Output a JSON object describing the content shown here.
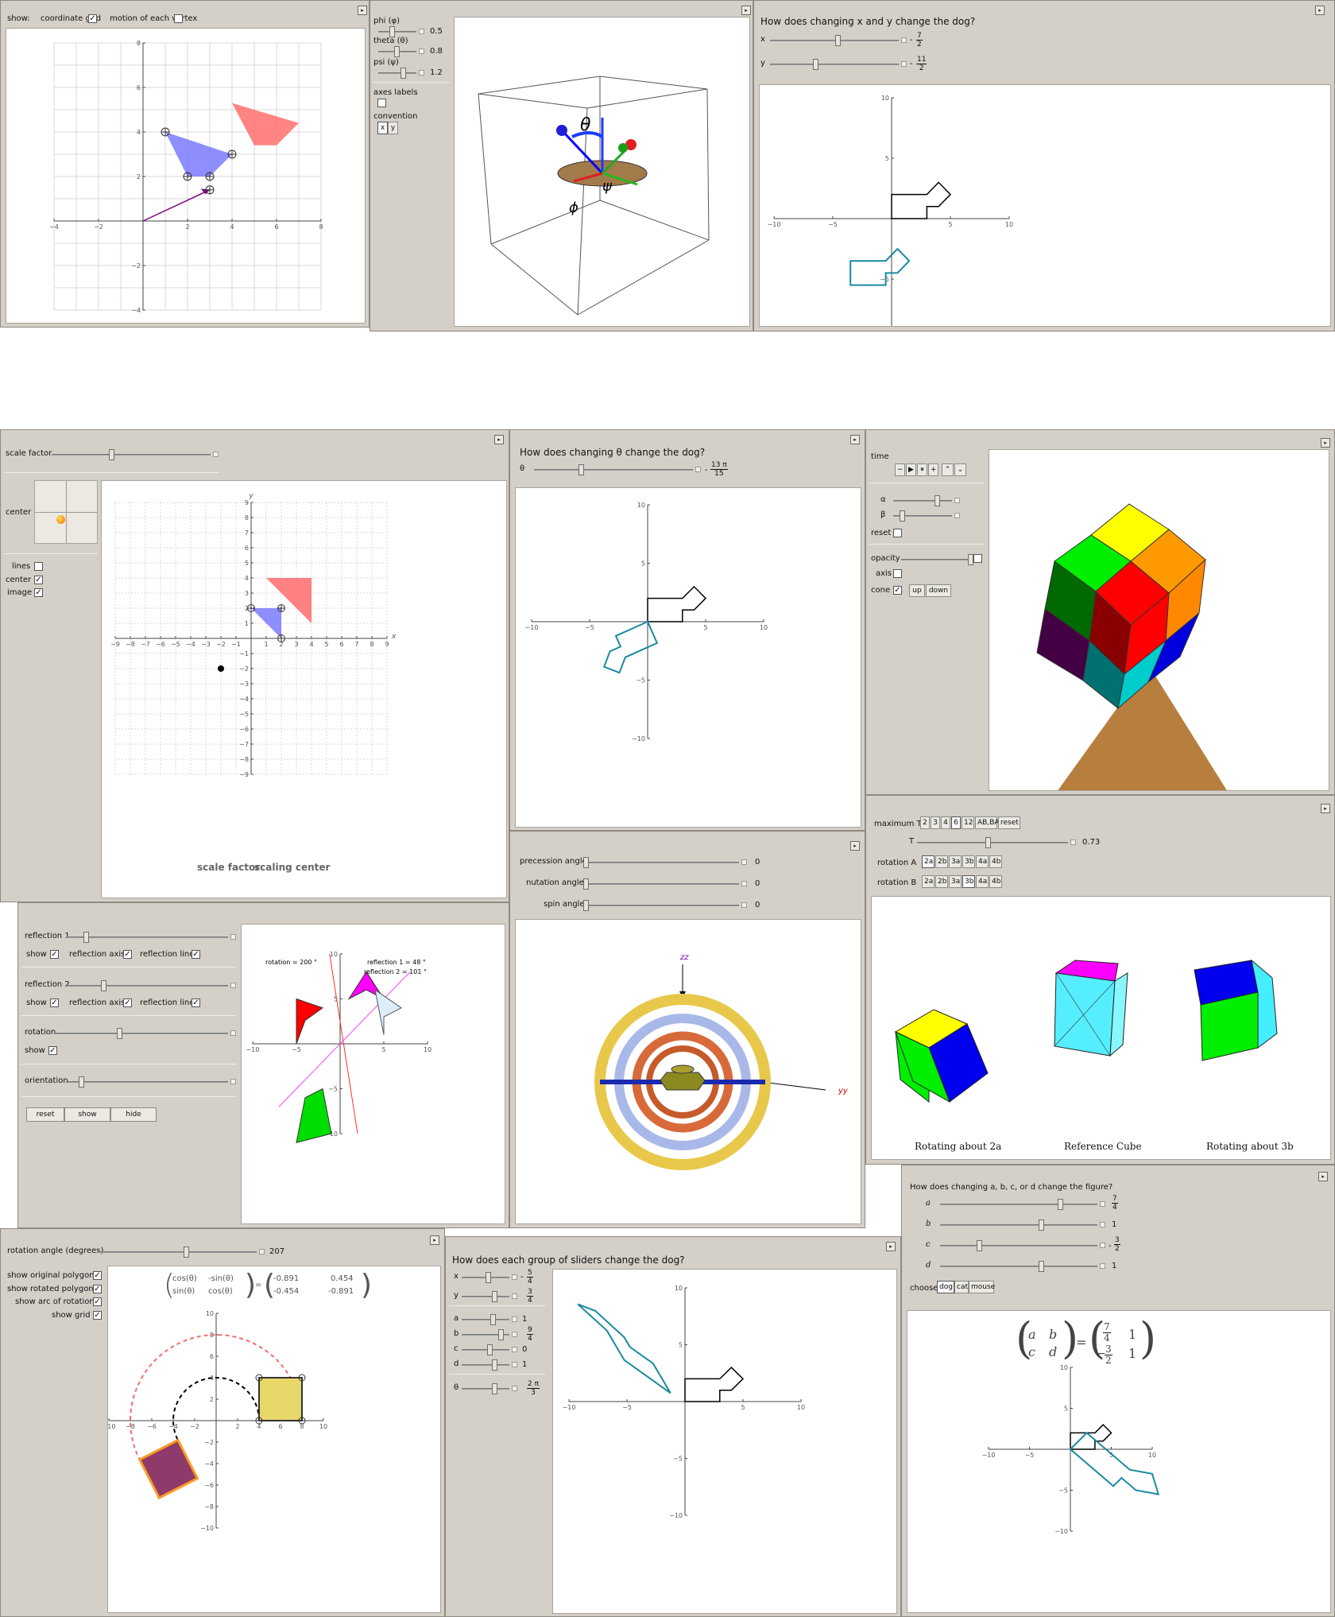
{
  "panel1": {
    "show_label": "show:",
    "coordinate_grid": "coordinate grid",
    "motion_each_vertex": "motion of each vertex"
  },
  "panel2": {
    "phi": "phi (φ)",
    "phi_val": "0.5",
    "theta": "theta (θ)",
    "theta_val": "0.8",
    "psi": "psi (ψ)",
    "psi_val": "1.2",
    "axes_labels": "axes labels",
    "convention": "convention",
    "conv_x": "x",
    "conv_y": "y",
    "lbl_theta": "θ",
    "lbl_psi": "ψ",
    "lbl_phi": "ϕ"
  },
  "panel3": {
    "question": "How does changing x and y change the dog?",
    "x": "x",
    "x_num": "7",
    "x_den": "2",
    "y": "y",
    "y_num": "11",
    "y_den": "2",
    "neg": "-"
  },
  "panel4": {
    "scale_factor": "scale factor",
    "center": "center",
    "lines": "lines",
    "center_cb": "center",
    "image": "image",
    "footer1": "scale factor",
    "footer2": "scaling center",
    "x": "x",
    "y": "y"
  },
  "panel5": {
    "question": "How does changing θ change the dog?",
    "theta": "θ",
    "num": "13 π",
    "den": "15",
    "neg": "-"
  },
  "panel6": {
    "time": "time",
    "alpha": "α",
    "beta": "β",
    "reset": "reset",
    "opacity": "opacity",
    "axis": "axis",
    "cone": "cone",
    "up": "up",
    "down": "down"
  },
  "panel7": {
    "reflection1": "reflection 1",
    "reflection2": "reflection 2",
    "show": "show",
    "reflection_axis": "reflection axis",
    "reflection_line": "reflection line",
    "rotation": "rotation",
    "orientation": "orientation",
    "reset": "reset",
    "show_btn": "show",
    "hide": "hide",
    "rotation_text": "rotation = 200 °",
    "refl1_text": "reflection 1 = 48 °",
    "refl2_text": "reflection 2 = 101 °"
  },
  "panel8": {
    "precession": "precession angle",
    "nutation": "nutation angle",
    "spin": "spin angle",
    "val": "0",
    "z": "zz",
    "y": "yy"
  },
  "panel9": {
    "maximum": "maximum T",
    "t_buttons": [
      "2",
      "3",
      "4",
      "6",
      "12",
      "AB,BA",
      "reset"
    ],
    "T": "T",
    "T_val": "0.73",
    "rotationA": "rotation A",
    "rotationB": "rotation B",
    "rot_buttons": [
      "2a",
      "2b",
      "3a",
      "3b",
      "4a",
      "4b"
    ],
    "cap1": "Rotating about 2a",
    "cap2": "Reference Cube",
    "cap3": "Rotating about 3b"
  },
  "panel10": {
    "rotation_angle": "rotation angle (degrees)",
    "angle_val": "207",
    "show_original": "show original polygon",
    "show_rotated": "show rotated polygon",
    "show_arc": "show arc of rotation",
    "show_grid": "show grid",
    "m11": "cos(θ)",
    "m12": "-sin(θ)",
    "m21": "sin(θ)",
    "m22": "cos(θ)",
    "v11": "-0.891",
    "v12": "0.454",
    "v21": "-0.454",
    "v22": "-0.891"
  },
  "panel11": {
    "question": "How does each group of sliders change the dog?",
    "rows": [
      {
        "l": "x",
        "n": "5",
        "d": "4",
        "neg": "-"
      },
      {
        "l": "y",
        "n": "3",
        "d": "4",
        "neg": ""
      },
      {
        "l": "a",
        "v": "1"
      },
      {
        "l": "b",
        "n": "9",
        "d": "4",
        "neg": ""
      },
      {
        "l": "c",
        "v": "0"
      },
      {
        "l": "d",
        "v": "1"
      },
      {
        "l": "θ",
        "n": "2 π",
        "d": "3",
        "neg": ""
      }
    ]
  },
  "panel12": {
    "question": "How does changing a, b, c, or d change the figure?",
    "a": "a",
    "a_n": "7",
    "a_d": "4",
    "b": "b",
    "b_v": "1",
    "c": "c",
    "c_n": "3",
    "c_d": "2",
    "c_neg": "-",
    "d": "d",
    "d_v": "1",
    "choose": "choose",
    "dog": "dog",
    "cat": "cat",
    "mouse": "mouse",
    "ma": "a",
    "mb": "b",
    "mc": "c",
    "md": "d",
    "r11n": "7",
    "r11d": "4",
    "r12": "1",
    "r21n": "3",
    "r21d": "2",
    "r22": "1"
  }
}
